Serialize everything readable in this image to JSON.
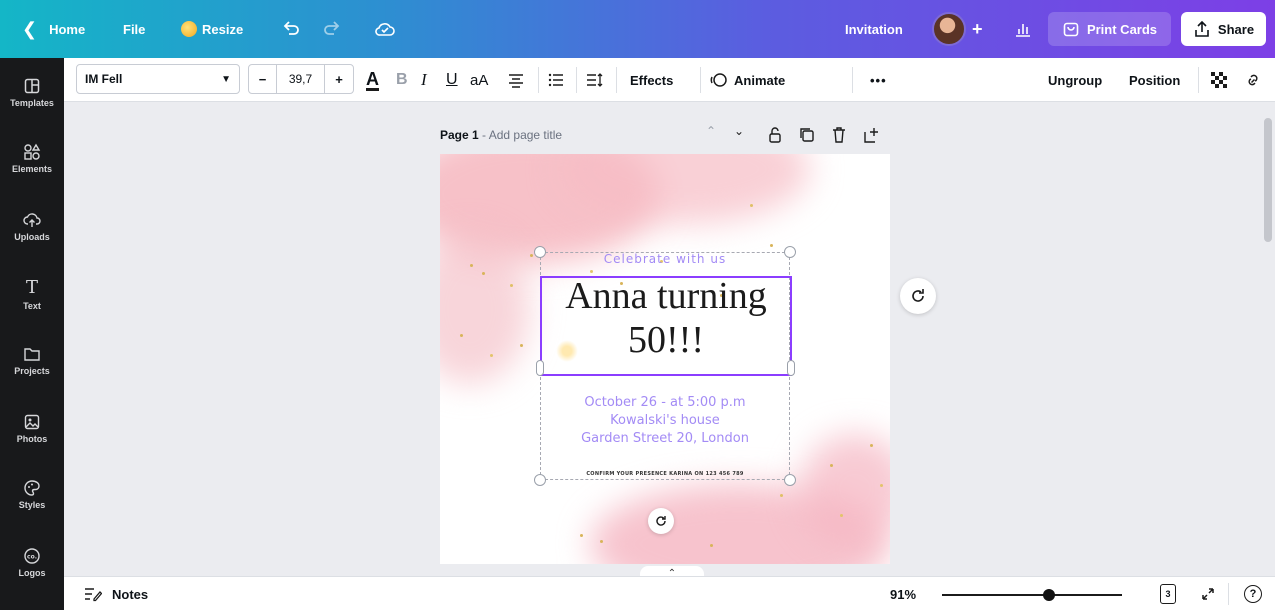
{
  "topbar": {
    "home_label": "Home",
    "file_label": "File",
    "resize_label": "Resize",
    "doc_title": "Invitation",
    "print_label": "Print Cards",
    "share_label": "Share"
  },
  "rail": {
    "items": [
      {
        "label": "Templates",
        "icon": "templates-icon"
      },
      {
        "label": "Elements",
        "icon": "elements-icon"
      },
      {
        "label": "Uploads",
        "icon": "uploads-icon"
      },
      {
        "label": "Text",
        "icon": "text-icon"
      },
      {
        "label": "Projects",
        "icon": "folder-icon"
      },
      {
        "label": "Photos",
        "icon": "photos-icon"
      },
      {
        "label": "Styles",
        "icon": "palette-icon"
      },
      {
        "label": "Logos",
        "icon": "logo-icon"
      }
    ]
  },
  "toolbar": {
    "font_name": "IM Fell",
    "font_size": "39,7",
    "effects_label": "Effects",
    "animate_label": "Animate",
    "more_label": "•••",
    "ungroup_label": "Ungroup",
    "position_label": "Position"
  },
  "page": {
    "label": "Page 1",
    "title_placeholder": "Add page title"
  },
  "invitation": {
    "celebrate": "Celebrate with us",
    "headline_1": "Anna turning",
    "headline_2": "50!!!",
    "date_line": "October 26 - at 5:00 p.m",
    "place_line": "Kowalski's house",
    "address_line": "Garden Street 20, London",
    "rsvp_line": "CONFIRM YOUR PRESENCE KARINA ON 123 456 789"
  },
  "bottombar": {
    "notes_label": "Notes",
    "zoom_level": "91%",
    "page_count": "3",
    "help_label": "?"
  },
  "colors": {
    "accent": "#8b3dff",
    "invite_purple": "#a38bf5",
    "blush": "#f4b6bd"
  }
}
